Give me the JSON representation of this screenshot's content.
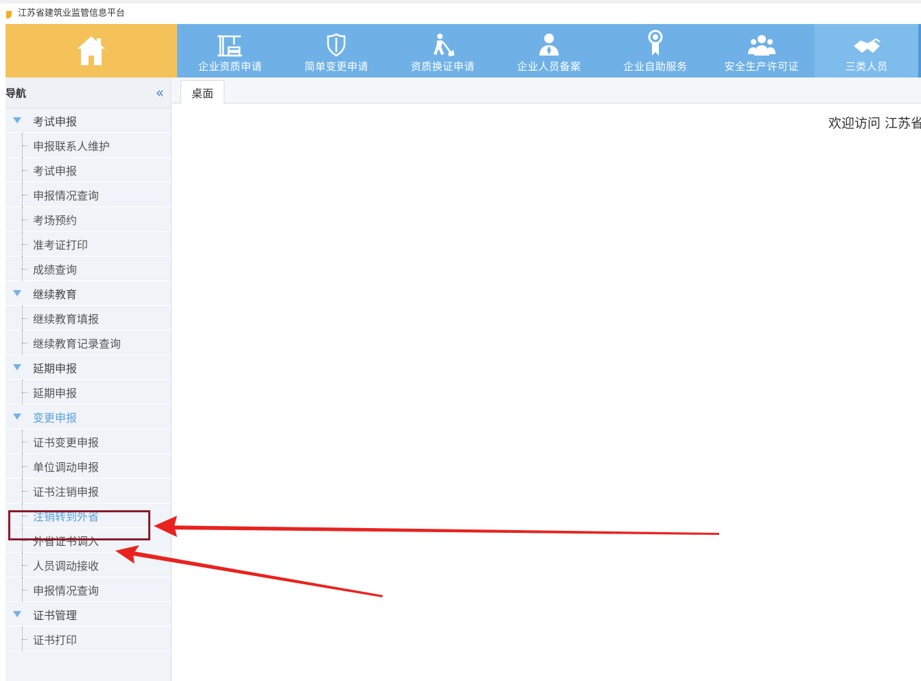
{
  "window": {
    "title": "江苏省建筑业监管信息平台"
  },
  "header": {
    "home_icon": "house-icon",
    "nav": [
      {
        "label": "企业资质申请",
        "icon": "crane-icon"
      },
      {
        "label": "简单变更申请",
        "icon": "shield-icon"
      },
      {
        "label": "资质换证申请",
        "icon": "worker-shovel-icon"
      },
      {
        "label": "企业人员备案",
        "icon": "person-icon"
      },
      {
        "label": "企业自助服务",
        "icon": "award-ribbon-icon"
      },
      {
        "label": "安全生产许可证",
        "icon": "group-icon"
      },
      {
        "label": "三类人员",
        "icon": "handshake-icon"
      }
    ]
  },
  "sidebar": {
    "title": "导航",
    "collapse_icon": "double-chevron-left-icon",
    "groups": [
      {
        "label": "考试申报",
        "items": [
          "申报联系人维护",
          "考试申报",
          "申报情况查询",
          "考场预约",
          "准考证打印",
          "成绩查询"
        ]
      },
      {
        "label": "继续教育",
        "items": [
          "继续教育填报",
          "继续教育记录查询"
        ]
      },
      {
        "label": "延期申报",
        "items": [
          "延期申报"
        ]
      },
      {
        "label": "变更申报",
        "items": [
          "证书变更申报",
          "单位调动申报",
          "证书注销申报",
          "注销转到外省",
          "外省证书调入",
          "人员调动接收",
          "申报情况查询"
        ]
      },
      {
        "label": "证书管理",
        "items": [
          "证书打印"
        ]
      }
    ]
  },
  "content": {
    "tab": "桌面",
    "welcome": "欢迎访问 江苏省"
  },
  "colors": {
    "header_blue": "#6fb1e6",
    "home_orange": "#f5c25a",
    "sidebar_bg": "#f0f3f7",
    "active_text": "#5aa0de",
    "annotation_red": "#e8231f",
    "highlight_border": "#8b1a2a"
  }
}
